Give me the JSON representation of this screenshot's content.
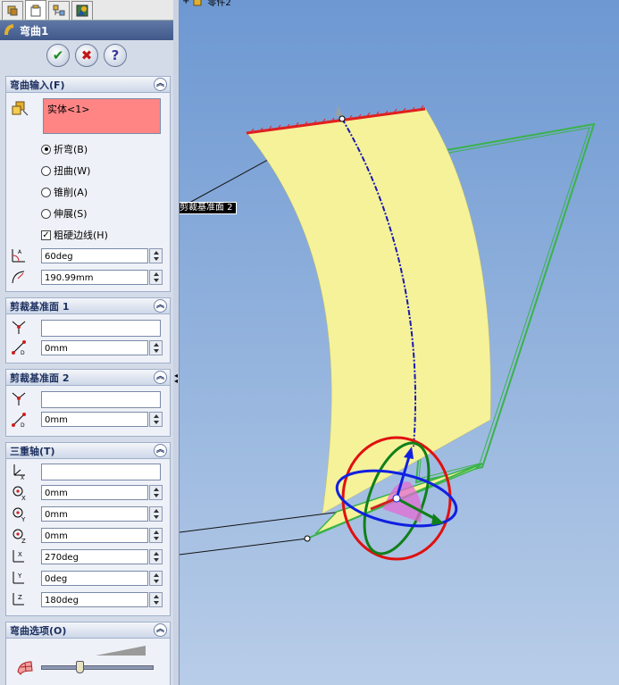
{
  "panel": {
    "title": "弯曲1",
    "tabs": [
      "property-manager",
      "configuration-manager",
      "dimxpert-manager",
      "display-manager"
    ],
    "buttons": {
      "ok": "✔",
      "cancel": "✖",
      "help": "?"
    }
  },
  "bend_input": {
    "header": "弯曲输入(F)",
    "selection": "实体<1>",
    "options": [
      {
        "label": "折弯(B)",
        "checked": true
      },
      {
        "label": "扭曲(W)",
        "checked": false
      },
      {
        "label": "锥削(A)",
        "checked": false
      },
      {
        "label": "伸展(S)",
        "checked": false
      }
    ],
    "hard_edges": {
      "label": "粗硬边线(H)",
      "checked": true
    },
    "angle": "60deg",
    "radius": "190.99mm"
  },
  "trim_plane1": {
    "header": "剪裁基准面 1",
    "distance": "0mm"
  },
  "trim_plane2": {
    "header": "剪裁基准面 2",
    "distance": "0mm"
  },
  "triad": {
    "header": "三重轴(T)",
    "x": "0mm",
    "y": "0mm",
    "z": "0mm",
    "rot_x": "270deg",
    "rot_y": "0deg",
    "rot_z": "180deg"
  },
  "bend_options": {
    "header": "弯曲选项(O)",
    "slider_level": 0.35
  },
  "viewport": {
    "tree_item": "零件2",
    "plane_label": "剪裁基准面 2",
    "colors": {
      "sheet": "#f5f29a",
      "trim_edge": "#e02020",
      "plane_outline": "#3ab34a",
      "axis_curve": "#1a1ab0"
    }
  }
}
